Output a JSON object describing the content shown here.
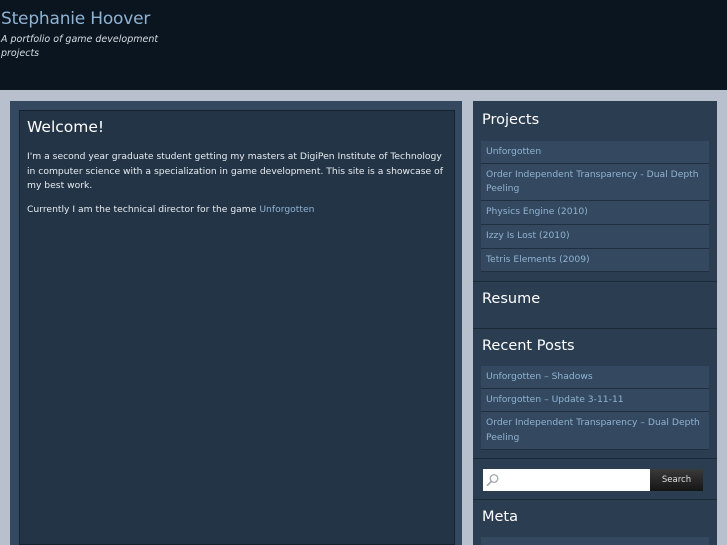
{
  "header": {
    "site_title": "Stephanie Hoover",
    "tagline": "A portfolio of game development projects"
  },
  "main": {
    "title": "Welcome!",
    "paragraph1": "I'm a second year graduate student getting my masters at DigiPen Institute of Technology in computer science with a specialization in game development.  This site is a showcase of my best work.",
    "paragraph2_prefix": "Currently I am the technical director for the game ",
    "paragraph2_link": "Unforgotten"
  },
  "sidebar": {
    "projects_title": "Projects",
    "projects": [
      "Unforgotten",
      "Order Independent Transparency - Dual Depth Peeling",
      "Physics Engine (2010)",
      "Izzy Is Lost (2010)",
      "Tetris Elements (2009)"
    ],
    "resume_title": "Resume",
    "recent_posts_title": "Recent Posts",
    "recent_posts": [
      "Unforgotten – Shadows",
      "Unforgotten – Update 3-11-11",
      "Order Independent Transparency – Dual Depth Peeling"
    ],
    "search_button": "Search",
    "search_value": "",
    "meta_title": "Meta"
  },
  "colors": {
    "link": "#8fb3d3",
    "panel_dark": "#233447",
    "panel_mid": "#34495f",
    "band": "#b7c0cc",
    "header_bg": "#0b1520"
  },
  "icons": {
    "search": "magnifier-icon"
  }
}
